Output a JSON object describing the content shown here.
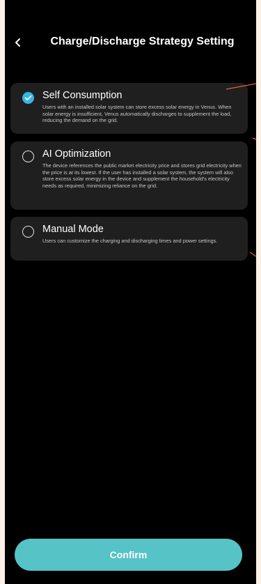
{
  "header": {
    "title": "Charge/Discharge Strategy Setting",
    "back_icon": "chevron-left-icon"
  },
  "options": [
    {
      "title": "Self Consumption",
      "description": "Users with an installed solar system can store excess solar energy in Venus. When solar energy is insufficient, Venus automatically discharges to supplement the load, reducing the demand on the grid.",
      "selected": true
    },
    {
      "title": "AI Optimization",
      "description": "The device references the public market electricity price and stores grid electricity when the price is at its lowest. If the user has installed a solar system, the system will also store excess solar energy in the device and supplement the household's electricity needs as required, minimizing reliance on the grid.",
      "selected": false
    },
    {
      "title": "Manual Mode",
      "description": "Users can customize the charging and discharging times and power settings.",
      "selected": false
    }
  ],
  "confirm_label": "Confirm",
  "colors": {
    "accent": "#34b7e6",
    "confirm_bg": "#56c3c7",
    "card_bg": "#1f1f1f",
    "pointer": "#e8603a"
  }
}
